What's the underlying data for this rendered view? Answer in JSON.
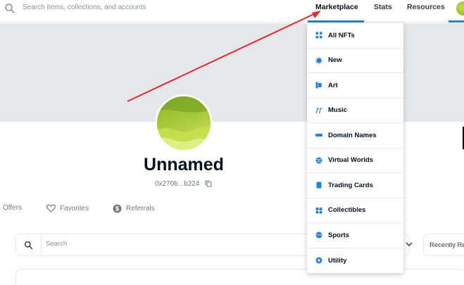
{
  "header": {
    "search_placeholder": "Search items, collections, and accounts",
    "nav": {
      "marketplace": "Marketplace",
      "stats": "Stats",
      "resources": "Resources"
    }
  },
  "profile": {
    "name": "Unnamed",
    "address": "0x270b...b224",
    "tabs": {
      "offers": "Offers",
      "favorites": "Favorites",
      "referrals": "Referrals"
    }
  },
  "filters": {
    "search_placeholder": "Search",
    "sort_label": "Recently Re"
  },
  "marketplace_menu": {
    "items": [
      {
        "label": "All NFTs",
        "icon": "all-nfts-icon",
        "color": "#2081e2"
      },
      {
        "label": "New",
        "icon": "new-icon",
        "color": "#2081e2"
      },
      {
        "label": "Art",
        "icon": "art-icon",
        "color": "#2081e2"
      },
      {
        "label": "Music",
        "icon": "music-icon",
        "color": "#2081e2"
      },
      {
        "label": "Domain Names",
        "icon": "domain-names-icon",
        "color": "#2081e2"
      },
      {
        "label": "Virtual Worlds",
        "icon": "virtual-worlds-icon",
        "color": "#2081e2"
      },
      {
        "label": "Trading Cards",
        "icon": "trading-cards-icon",
        "color": "#2081e2"
      },
      {
        "label": "Collectibles",
        "icon": "collectibles-icon",
        "color": "#2081e2"
      },
      {
        "label": "Sports",
        "icon": "sports-icon",
        "color": "#2081e2"
      },
      {
        "label": "Utility",
        "icon": "utility-icon",
        "color": "#2081e2"
      }
    ]
  },
  "annotation": {
    "arrow_color": "#e8262a"
  }
}
